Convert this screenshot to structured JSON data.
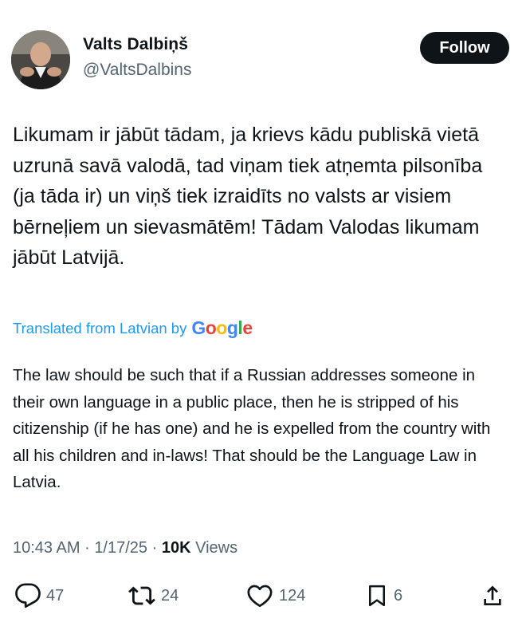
{
  "author": {
    "name": "Valts Dalbiņš",
    "handle": "@ValtsDalbins"
  },
  "follow_label": "Follow",
  "tweet": {
    "original_text": "Likumam ir jābūt tādam, ja krievs kādu publiskā vietā uzrunā savā valodā, tad viņam tiek atņemta pilsonība (ja tāda ir) un viņš tiek izraidīts no valsts ar visiem bērneļiem un sievasmātēm! Tādam Valodas likumam jābūt Latvijā.",
    "translated_label": "Translated from Latvian by",
    "translator_logo": "Google",
    "translation_text": "The law should be such that if a Russian addresses someone in their own language in a public place, then he is stripped of his citizenship (if he has one) and he is expelled from the country with all his children and in-laws! That should be the Language Law in Latvia."
  },
  "meta": {
    "time": "10:43 AM",
    "separator": "·",
    "date": "1/17/25",
    "views_count": "10K",
    "views_label": "Views"
  },
  "actions": {
    "replies": "47",
    "reposts": "24",
    "likes": "124",
    "bookmarks": "6"
  },
  "icons": [
    "avatar-photo",
    "reply-icon",
    "repost-icon",
    "like-icon",
    "bookmark-icon",
    "share-icon"
  ],
  "colors": {
    "text": "#0f1419",
    "secondary": "#536471",
    "link": "#1d9bf0",
    "button_bg": "#0f1419"
  }
}
